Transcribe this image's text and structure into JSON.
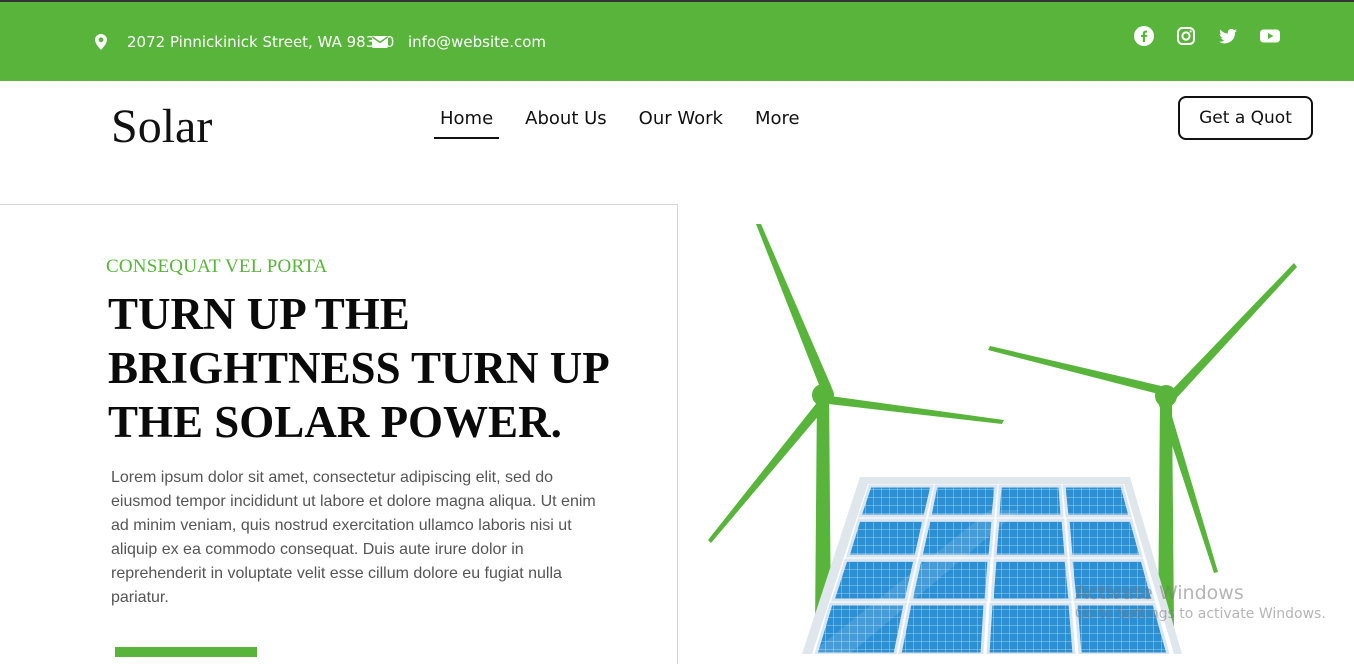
{
  "topbar": {
    "address": "2072 Pinnickinick Street, WA 98370",
    "email": "info@website.com",
    "bg_color": "#58b43b",
    "icons": [
      "map-marker-icon",
      "envelope-icon"
    ],
    "socials": [
      "facebook-icon",
      "instagram-icon",
      "twitter-icon",
      "youtube-icon"
    ]
  },
  "header": {
    "brand": "Solar",
    "nav": [
      "Home",
      "About Us",
      "Our Work",
      "More"
    ],
    "active_nav": "Home",
    "cta": "Get a Quot"
  },
  "hero": {
    "eyebrow": "CONSEQUAT VEL PORTA",
    "headline": "TURN UP THE BRIGHTNESS TURN UP THE SOLAR POWER.",
    "body": "Lorem ipsum dolor sit amet, consectetur adipiscing elit, sed do eiusmod tempor incididunt ut labore et dolore magna aliqua. Ut enim ad minim veniam, quis nostrud exercitation ullamco laboris nisi ut aliquip ex ea commodo consequat. Duis aute irure dolor in reprehenderit in voluptate velit esse cillum dolore eu fugiat nulla pariatur.",
    "accent_color": "#58b43b"
  },
  "watermark": {
    "title": "Activate Windows",
    "subtitle": "Go to Settings to activate Windows."
  }
}
